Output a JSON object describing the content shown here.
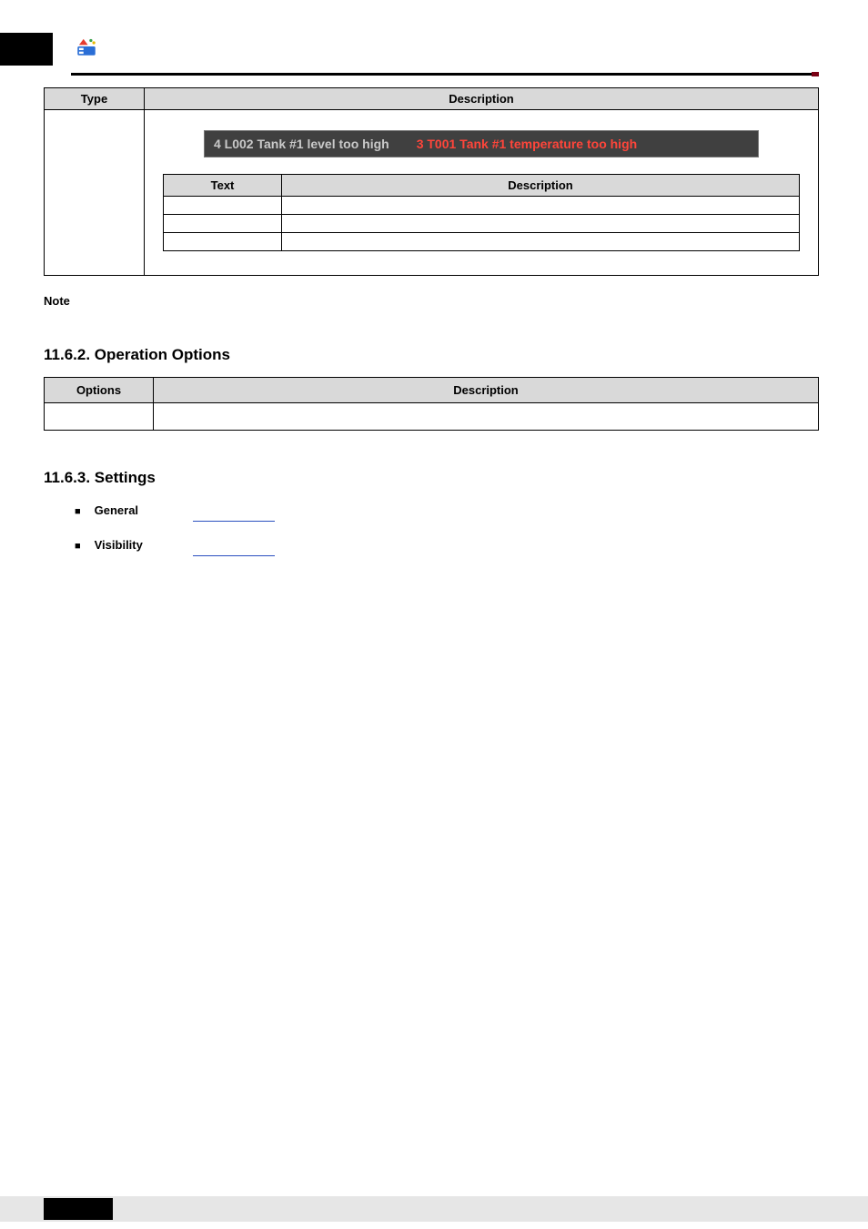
{
  "table1": {
    "headers": {
      "type": "Type",
      "description": "Description"
    },
    "marquee": {
      "left": "4  L002  Tank #1 level too high",
      "right": "3  T001  Tank #1 temperature too high"
    },
    "inner_headers": {
      "text": "Text",
      "description": "Description"
    }
  },
  "note": {
    "label": "Note"
  },
  "section_ops": {
    "heading": "11.6.2. Operation Options",
    "headers": {
      "options": "Options",
      "description": "Description"
    }
  },
  "section_settings": {
    "heading": "11.6.3. Settings",
    "items": [
      {
        "label": "General"
      },
      {
        "label": "Visibility"
      }
    ]
  }
}
